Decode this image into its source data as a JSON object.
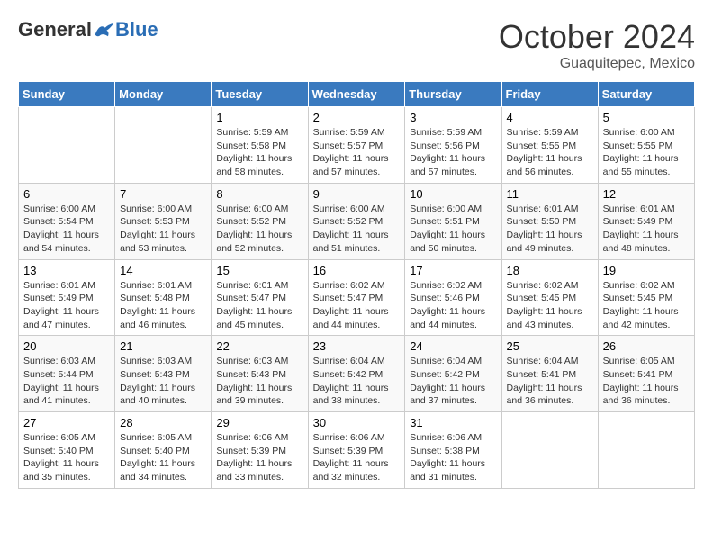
{
  "header": {
    "logo_general": "General",
    "logo_blue": "Blue",
    "month": "October 2024",
    "location": "Guaquitepec, Mexico"
  },
  "weekdays": [
    "Sunday",
    "Monday",
    "Tuesday",
    "Wednesday",
    "Thursday",
    "Friday",
    "Saturday"
  ],
  "weeks": [
    [
      {
        "day": "",
        "info": ""
      },
      {
        "day": "",
        "info": ""
      },
      {
        "day": "1",
        "info": "Sunrise: 5:59 AM\nSunset: 5:58 PM\nDaylight: 11 hours and 58 minutes."
      },
      {
        "day": "2",
        "info": "Sunrise: 5:59 AM\nSunset: 5:57 PM\nDaylight: 11 hours and 57 minutes."
      },
      {
        "day": "3",
        "info": "Sunrise: 5:59 AM\nSunset: 5:56 PM\nDaylight: 11 hours and 57 minutes."
      },
      {
        "day": "4",
        "info": "Sunrise: 5:59 AM\nSunset: 5:55 PM\nDaylight: 11 hours and 56 minutes."
      },
      {
        "day": "5",
        "info": "Sunrise: 6:00 AM\nSunset: 5:55 PM\nDaylight: 11 hours and 55 minutes."
      }
    ],
    [
      {
        "day": "6",
        "info": "Sunrise: 6:00 AM\nSunset: 5:54 PM\nDaylight: 11 hours and 54 minutes."
      },
      {
        "day": "7",
        "info": "Sunrise: 6:00 AM\nSunset: 5:53 PM\nDaylight: 11 hours and 53 minutes."
      },
      {
        "day": "8",
        "info": "Sunrise: 6:00 AM\nSunset: 5:52 PM\nDaylight: 11 hours and 52 minutes."
      },
      {
        "day": "9",
        "info": "Sunrise: 6:00 AM\nSunset: 5:52 PM\nDaylight: 11 hours and 51 minutes."
      },
      {
        "day": "10",
        "info": "Sunrise: 6:00 AM\nSunset: 5:51 PM\nDaylight: 11 hours and 50 minutes."
      },
      {
        "day": "11",
        "info": "Sunrise: 6:01 AM\nSunset: 5:50 PM\nDaylight: 11 hours and 49 minutes."
      },
      {
        "day": "12",
        "info": "Sunrise: 6:01 AM\nSunset: 5:49 PM\nDaylight: 11 hours and 48 minutes."
      }
    ],
    [
      {
        "day": "13",
        "info": "Sunrise: 6:01 AM\nSunset: 5:49 PM\nDaylight: 11 hours and 47 minutes."
      },
      {
        "day": "14",
        "info": "Sunrise: 6:01 AM\nSunset: 5:48 PM\nDaylight: 11 hours and 46 minutes."
      },
      {
        "day": "15",
        "info": "Sunrise: 6:01 AM\nSunset: 5:47 PM\nDaylight: 11 hours and 45 minutes."
      },
      {
        "day": "16",
        "info": "Sunrise: 6:02 AM\nSunset: 5:47 PM\nDaylight: 11 hours and 44 minutes."
      },
      {
        "day": "17",
        "info": "Sunrise: 6:02 AM\nSunset: 5:46 PM\nDaylight: 11 hours and 44 minutes."
      },
      {
        "day": "18",
        "info": "Sunrise: 6:02 AM\nSunset: 5:45 PM\nDaylight: 11 hours and 43 minutes."
      },
      {
        "day": "19",
        "info": "Sunrise: 6:02 AM\nSunset: 5:45 PM\nDaylight: 11 hours and 42 minutes."
      }
    ],
    [
      {
        "day": "20",
        "info": "Sunrise: 6:03 AM\nSunset: 5:44 PM\nDaylight: 11 hours and 41 minutes."
      },
      {
        "day": "21",
        "info": "Sunrise: 6:03 AM\nSunset: 5:43 PM\nDaylight: 11 hours and 40 minutes."
      },
      {
        "day": "22",
        "info": "Sunrise: 6:03 AM\nSunset: 5:43 PM\nDaylight: 11 hours and 39 minutes."
      },
      {
        "day": "23",
        "info": "Sunrise: 6:04 AM\nSunset: 5:42 PM\nDaylight: 11 hours and 38 minutes."
      },
      {
        "day": "24",
        "info": "Sunrise: 6:04 AM\nSunset: 5:42 PM\nDaylight: 11 hours and 37 minutes."
      },
      {
        "day": "25",
        "info": "Sunrise: 6:04 AM\nSunset: 5:41 PM\nDaylight: 11 hours and 36 minutes."
      },
      {
        "day": "26",
        "info": "Sunrise: 6:05 AM\nSunset: 5:41 PM\nDaylight: 11 hours and 36 minutes."
      }
    ],
    [
      {
        "day": "27",
        "info": "Sunrise: 6:05 AM\nSunset: 5:40 PM\nDaylight: 11 hours and 35 minutes."
      },
      {
        "day": "28",
        "info": "Sunrise: 6:05 AM\nSunset: 5:40 PM\nDaylight: 11 hours and 34 minutes."
      },
      {
        "day": "29",
        "info": "Sunrise: 6:06 AM\nSunset: 5:39 PM\nDaylight: 11 hours and 33 minutes."
      },
      {
        "day": "30",
        "info": "Sunrise: 6:06 AM\nSunset: 5:39 PM\nDaylight: 11 hours and 32 minutes."
      },
      {
        "day": "31",
        "info": "Sunrise: 6:06 AM\nSunset: 5:38 PM\nDaylight: 11 hours and 31 minutes."
      },
      {
        "day": "",
        "info": ""
      },
      {
        "day": "",
        "info": ""
      }
    ]
  ]
}
